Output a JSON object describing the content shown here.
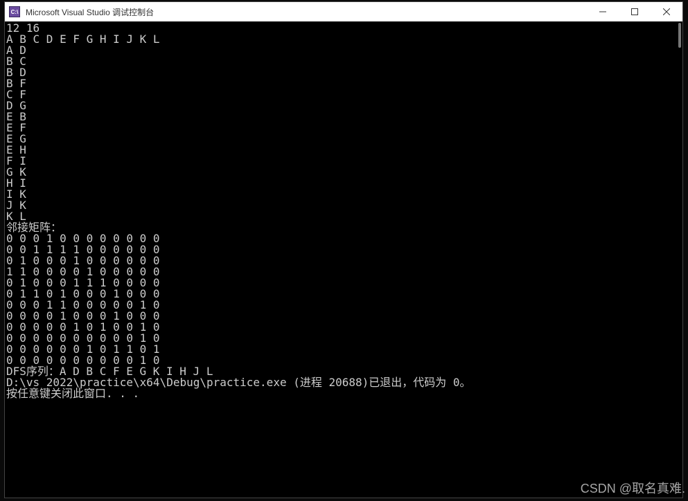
{
  "window": {
    "app_icon_text": "C:\\",
    "title": "Microsoft Visual Studio 调试控制台"
  },
  "console": {
    "input_header": "12 16",
    "vertices_line": "A B C D E F G H I J K L",
    "edges": [
      "A D",
      "B C",
      "B D",
      "B F",
      "C F",
      "D G",
      "E B",
      "E F",
      "E G",
      "E H",
      "F I",
      "G K",
      "H I",
      "I K",
      "J K",
      "K L"
    ],
    "matrix_label": "邻接矩阵：",
    "matrix": [
      "0 0 0 1 0 0 0 0 0 0 0 0",
      "0 0 1 1 1 1 0 0 0 0 0 0",
      "0 1 0 0 0 1 0 0 0 0 0 0",
      "1 1 0 0 0 0 1 0 0 0 0 0",
      "0 1 0 0 0 1 1 1 0 0 0 0",
      "0 1 1 0 1 0 0 0 1 0 0 0",
      "0 0 0 1 1 0 0 0 0 0 1 0",
      "0 0 0 0 1 0 0 0 1 0 0 0",
      "0 0 0 0 0 1 0 1 0 0 1 0",
      "0 0 0 0 0 0 0 0 0 0 1 0",
      "0 0 0 0 0 0 1 0 1 1 0 1",
      "0 0 0 0 0 0 0 0 0 0 1 0"
    ],
    "dfs_line": "DFS序列：A D B C F E G K I H J L ",
    "exit_line": "D:\\vs 2022\\practice\\x64\\Debug\\practice.exe (进程 20688)已退出，代码为 0。",
    "prompt_line": "按任意键关闭此窗口. . ."
  },
  "watermark": "CSDN @取名真难."
}
